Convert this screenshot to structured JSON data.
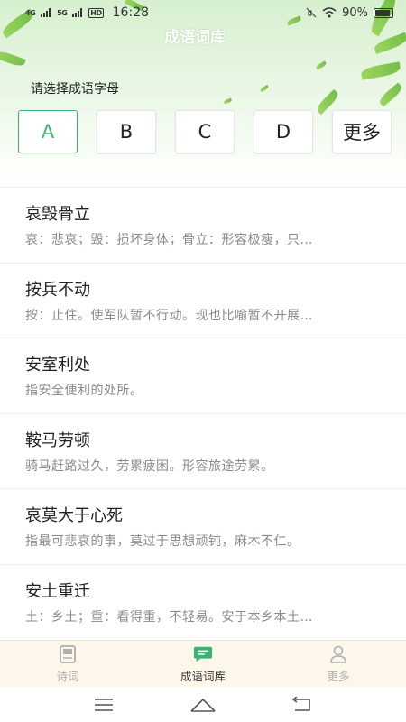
{
  "status_bar": {
    "signal_1": "4G",
    "signal_2": "5G",
    "hd_badge": "HD",
    "time": "16:28",
    "battery_text": "90%",
    "battery_level": 0.9
  },
  "header": {
    "title": "成语词库"
  },
  "letter_picker": {
    "prompt": "请选择成语字母",
    "letters": [
      {
        "label": "A",
        "active": true
      },
      {
        "label": "B",
        "active": false
      },
      {
        "label": "C",
        "active": false
      },
      {
        "label": "D",
        "active": false
      },
      {
        "label": "更多",
        "active": false
      }
    ]
  },
  "idioms": [
    {
      "title": "哀毁骨立",
      "desc": "哀：悲哀；毁：损坏身体；骨立：形容极瘦，只…"
    },
    {
      "title": "按兵不动",
      "desc": "按：止住。使军队暂不行动。现也比喻暂不开展…"
    },
    {
      "title": "安室利处",
      "desc": "指安全便利的处所。"
    },
    {
      "title": "鞍马劳顿",
      "desc": "骑马赶路过久，劳累疲困。形容旅途劳累。"
    },
    {
      "title": "哀莫大于心死",
      "desc": "指最可悲哀的事，莫过于思想顽钝，麻木不仁。"
    },
    {
      "title": "安土重迁",
      "desc": "土：乡土；重：看得重，不轻易。安于本乡本土…"
    }
  ],
  "bottom_nav": {
    "items": [
      {
        "label": "诗词",
        "icon": "book-icon",
        "active": false
      },
      {
        "label": "成语词库",
        "icon": "chat-bubble-icon",
        "active": true
      },
      {
        "label": "更多",
        "icon": "user-icon",
        "active": false
      }
    ]
  },
  "colors": {
    "accent": "#3cb371",
    "nav_bg": "#fdf6ea"
  }
}
